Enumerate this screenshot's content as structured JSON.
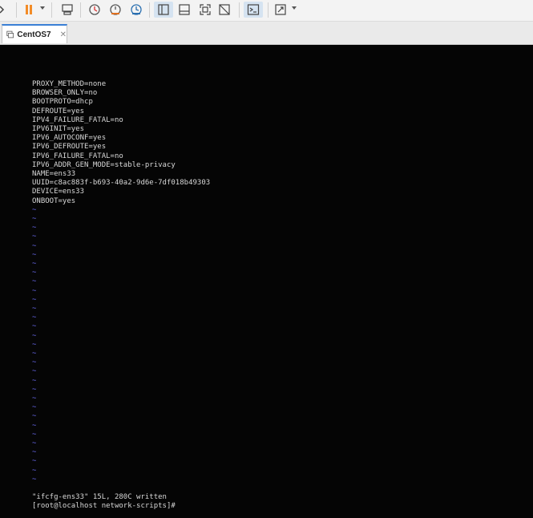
{
  "tab": {
    "title": "CentOS7",
    "close_glyph": "✕"
  },
  "console": {
    "lines": [
      "PROXY_METHOD=none",
      "BROWSER_ONLY=no",
      "BOOTPROTO=dhcp",
      "DEFROUTE=yes",
      "IPV4_FAILURE_FATAL=no",
      "IPV6INIT=yes",
      "IPV6_AUTOCONF=yes",
      "IPV6_DEFROUTE=yes",
      "IPV6_FAILURE_FATAL=no",
      "IPV6_ADDR_GEN_MODE=stable-privacy",
      "NAME=ens33",
      "UUID=c8ac883f-b693-40a2-9d6e-7df018b49303",
      "DEVICE=ens33",
      "ONBOOT=yes"
    ],
    "tilde_char": "~",
    "tilde_count": 31,
    "status_message": "\"ifcfg-ens33\" 15L, 280C written",
    "prompt": "[root@localhost network-scripts]#"
  },
  "colors": {
    "console_bg": "#050505",
    "console_text": "#d8d8d8",
    "tilde": "#6a6af0",
    "pause_accent": "#f28c28",
    "tab_accent": "#3a7fd5"
  },
  "icons": [
    "power-icon",
    "pause-icon",
    "send-ctrl-alt-del-icon",
    "snapshot-icon",
    "revert-snapshot-icon",
    "snapshot-manager-icon",
    "show-library-icon",
    "thumbnail-bar-icon",
    "full-screen-icon",
    "unity-icon",
    "console-view-icon",
    "stretch-guest-icon",
    "vm-tab-icon"
  ]
}
